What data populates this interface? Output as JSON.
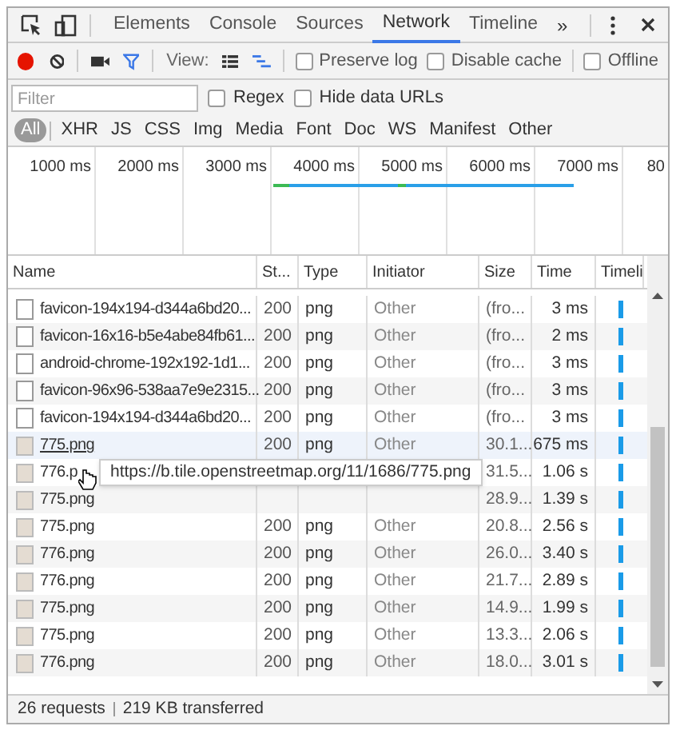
{
  "panel_tabs": [
    {
      "label": "Elements",
      "selected": false
    },
    {
      "label": "Console",
      "selected": false
    },
    {
      "label": "Sources",
      "selected": false
    },
    {
      "label": "Network",
      "selected": true
    },
    {
      "label": "Timeline",
      "selected": false
    }
  ],
  "more_tabs": "»",
  "toolbar": {
    "recording": true,
    "filter_active": true,
    "view_label": "View:",
    "options": [
      {
        "label": "Preserve log",
        "checked": false
      },
      {
        "label": "Disable cache",
        "checked": false
      },
      {
        "label": "Offline",
        "checked": false
      }
    ]
  },
  "filter": {
    "placeholder": "Filter",
    "options": [
      {
        "label": "Regex",
        "checked": false
      },
      {
        "label": "Hide data URLs",
        "checked": false
      }
    ]
  },
  "type_filters": [
    {
      "label": "All",
      "selected": true
    },
    {
      "label": "XHR",
      "selected": false
    },
    {
      "label": "JS",
      "selected": false
    },
    {
      "label": "CSS",
      "selected": false
    },
    {
      "label": "Img",
      "selected": false
    },
    {
      "label": "Media",
      "selected": false
    },
    {
      "label": "Font",
      "selected": false
    },
    {
      "label": "Doc",
      "selected": false
    },
    {
      "label": "WS",
      "selected": false
    },
    {
      "label": "Manifest",
      "selected": false
    },
    {
      "label": "Other",
      "selected": false
    }
  ],
  "overview_ticks": [
    "1000 ms",
    "2000 ms",
    "3000 ms",
    "4000 ms",
    "5000 ms",
    "6000 ms",
    "7000 ms",
    "80"
  ],
  "table": {
    "columns": [
      "Name",
      "St...",
      "Type",
      "Initiator",
      "Size",
      "Time",
      "Timeli"
    ],
    "rows": [
      {
        "kind": "document",
        "name": "favicon-194x194-d344a6bd20...",
        "status": "200",
        "type": "png",
        "initiator": "Other",
        "size": "(fro...",
        "time": "3 ms",
        "selected": false
      },
      {
        "kind": "document",
        "name": "favicon-16x16-b5e4abe84fb61...",
        "status": "200",
        "type": "png",
        "initiator": "Other",
        "size": "(fro...",
        "time": "2 ms",
        "selected": false
      },
      {
        "kind": "document",
        "name": "android-chrome-192x192-1d1...",
        "status": "200",
        "type": "png",
        "initiator": "Other",
        "size": "(fro...",
        "time": "3 ms",
        "selected": false
      },
      {
        "kind": "document",
        "name": "favicon-96x96-538aa7e9e2315...",
        "status": "200",
        "type": "png",
        "initiator": "Other",
        "size": "(fro...",
        "time": "3 ms",
        "selected": false
      },
      {
        "kind": "document",
        "name": "favicon-194x194-d344a6bd20...",
        "status": "200",
        "type": "png",
        "initiator": "Other",
        "size": "(fro...",
        "time": "3 ms",
        "selected": false
      },
      {
        "kind": "image",
        "name": "775.png",
        "status": "200",
        "type": "png",
        "initiator": "Other",
        "size": "30.1...",
        "time": "675 ms",
        "selected": true
      },
      {
        "kind": "image",
        "name": "776.p",
        "size": "31.5...",
        "time": "1.06 s",
        "selected": false
      },
      {
        "kind": "image",
        "name": "775.png",
        "size": "28.9...",
        "time": "1.39 s",
        "selected": false
      },
      {
        "kind": "image",
        "name": "775.png",
        "status": "200",
        "type": "png",
        "initiator": "Other",
        "size": "20.8...",
        "time": "2.56 s",
        "selected": false
      },
      {
        "kind": "image",
        "name": "776.png",
        "status": "200",
        "type": "png",
        "initiator": "Other",
        "size": "26.0...",
        "time": "3.40 s",
        "selected": false
      },
      {
        "kind": "image",
        "name": "776.png",
        "status": "200",
        "type": "png",
        "initiator": "Other",
        "size": "21.7...",
        "time": "2.89 s",
        "selected": false
      },
      {
        "kind": "image",
        "name": "775.png",
        "status": "200",
        "type": "png",
        "initiator": "Other",
        "size": "14.9...",
        "time": "1.99 s",
        "selected": false
      },
      {
        "kind": "image",
        "name": "775.png",
        "status": "200",
        "type": "png",
        "initiator": "Other",
        "size": "13.3...",
        "time": "2.06 s",
        "selected": false
      },
      {
        "kind": "image",
        "name": "776.png",
        "status": "200",
        "type": "png",
        "initiator": "Other",
        "size": "18.0...",
        "time": "3.01 s",
        "selected": false
      }
    ]
  },
  "tooltip": "https://b.tile.openstreetmap.org/11/1686/775.png",
  "status_bar": {
    "requests": "26 requests",
    "transferred": "219 KB transferred"
  }
}
